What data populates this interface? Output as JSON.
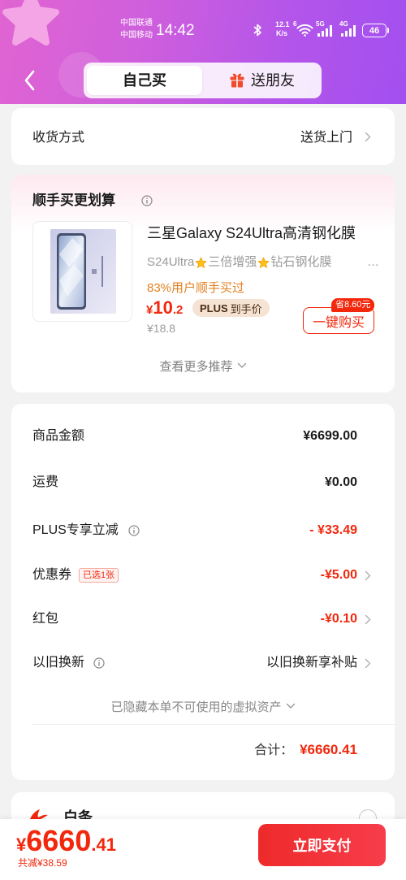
{
  "status_bar": {
    "carrier_1": "中国联通",
    "carrier_2": "中国移动",
    "time": "14:42",
    "net_speed": "12.1",
    "net_speed_unit": "K/s",
    "wifi_badge": "6",
    "network_1": "5G",
    "network_2": "4G",
    "battery": "46"
  },
  "header": {
    "tab_self": "自己买",
    "tab_gift": "送朋友"
  },
  "delivery": {
    "label": "收货方式",
    "value": "送货上门"
  },
  "recommend": {
    "title": "顺手买更划算",
    "product": {
      "title": "三星Galaxy S24Ultra高清钢化膜",
      "subtitle_parts": [
        "S24Ultra",
        "三倍增强",
        "钻石钢化膜"
      ],
      "subtitle_more": "…",
      "social_proof": "83%用户顺手买过",
      "price_symbol": "¥",
      "price_int": "10",
      "price_dec": ".2",
      "plus_label": "PLUS",
      "plus_suffix": "到手价",
      "original_price": "¥18.8",
      "save_badge": "省8.60元",
      "buy_button": "一键购买"
    },
    "more_link": "查看更多推荐"
  },
  "summary": {
    "rows": [
      {
        "label": "商品金额",
        "value": "¥6699.00"
      },
      {
        "label": "运费",
        "value": "¥0.00"
      },
      {
        "label": "PLUS专享立减",
        "value": "- ¥33.49"
      },
      {
        "label": "优惠券",
        "tag": "已选1张",
        "value": "-¥5.00"
      },
      {
        "label": "红包",
        "value": "-¥0.10"
      },
      {
        "label": "以旧换新",
        "value": "以旧换新享补贴"
      }
    ],
    "hidden_assets": "已隐藏本单不可使用的虚拟资产",
    "total_label": "合计：",
    "total_value": "¥6660.41"
  },
  "payment": {
    "method": "白条"
  },
  "bottom_bar": {
    "price_symbol": "¥",
    "price_int": "6660",
    "price_dec": ".41",
    "saved": "共减¥38.59",
    "pay_button": "立即支付"
  },
  "icons": [
    "bluetooth-icon",
    "wifi-icon",
    "signal-icon",
    "battery-icon",
    "chevron-left-icon",
    "gift-icon",
    "info-icon",
    "star-icon",
    "chevron-right-icon",
    "chevron-down-icon",
    "payment-method-icon",
    "radio-icon"
  ],
  "colors": {
    "brand_red": "#f2270c",
    "header_gradient_start": "#e064d2",
    "header_gradient_end": "#a24ff0",
    "social_proof_orange": "#e3801f",
    "plus_badge_bg": "#f5e3d3",
    "page_background": "#f2f2f2"
  }
}
